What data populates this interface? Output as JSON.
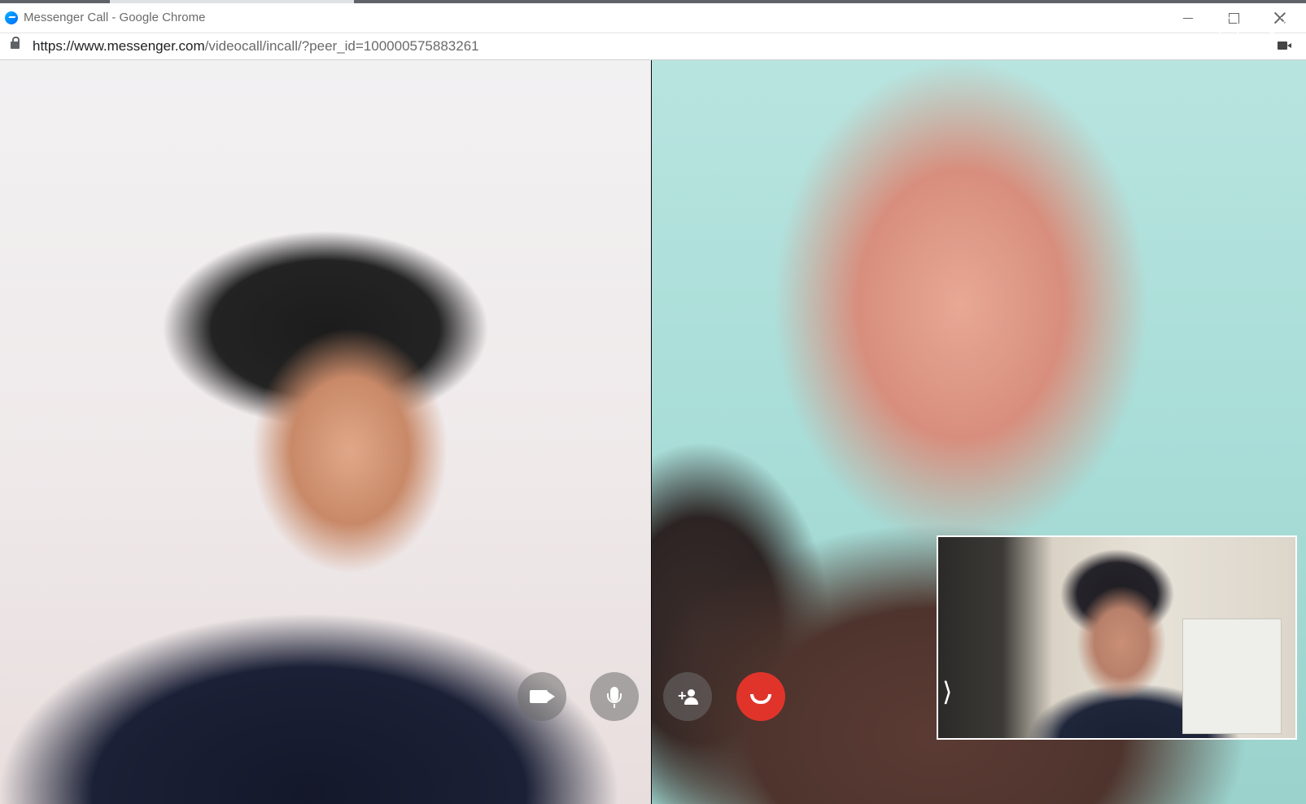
{
  "window": {
    "title": "Messenger Call - Google Chrome",
    "tab_label": "Messenger"
  },
  "address_bar": {
    "url_host": "https://www.messenger.com",
    "url_path": "/videocall/incall/?peer_id=100000575883261"
  },
  "icons": {
    "app": "messenger-icon",
    "lock": "lock-icon",
    "camera_indicator": "camera-in-use-icon",
    "layout": "layout-icon",
    "fullscreen": "fullscreen-icon",
    "pip_toggle": "chevron-right-icon",
    "video": "video-camera-icon",
    "mic": "microphone-icon",
    "add_user": "add-person-icon",
    "end_call": "end-call-icon"
  },
  "colors": {
    "end_call": "#e0342b",
    "control_bg": "#6e6e6e"
  }
}
